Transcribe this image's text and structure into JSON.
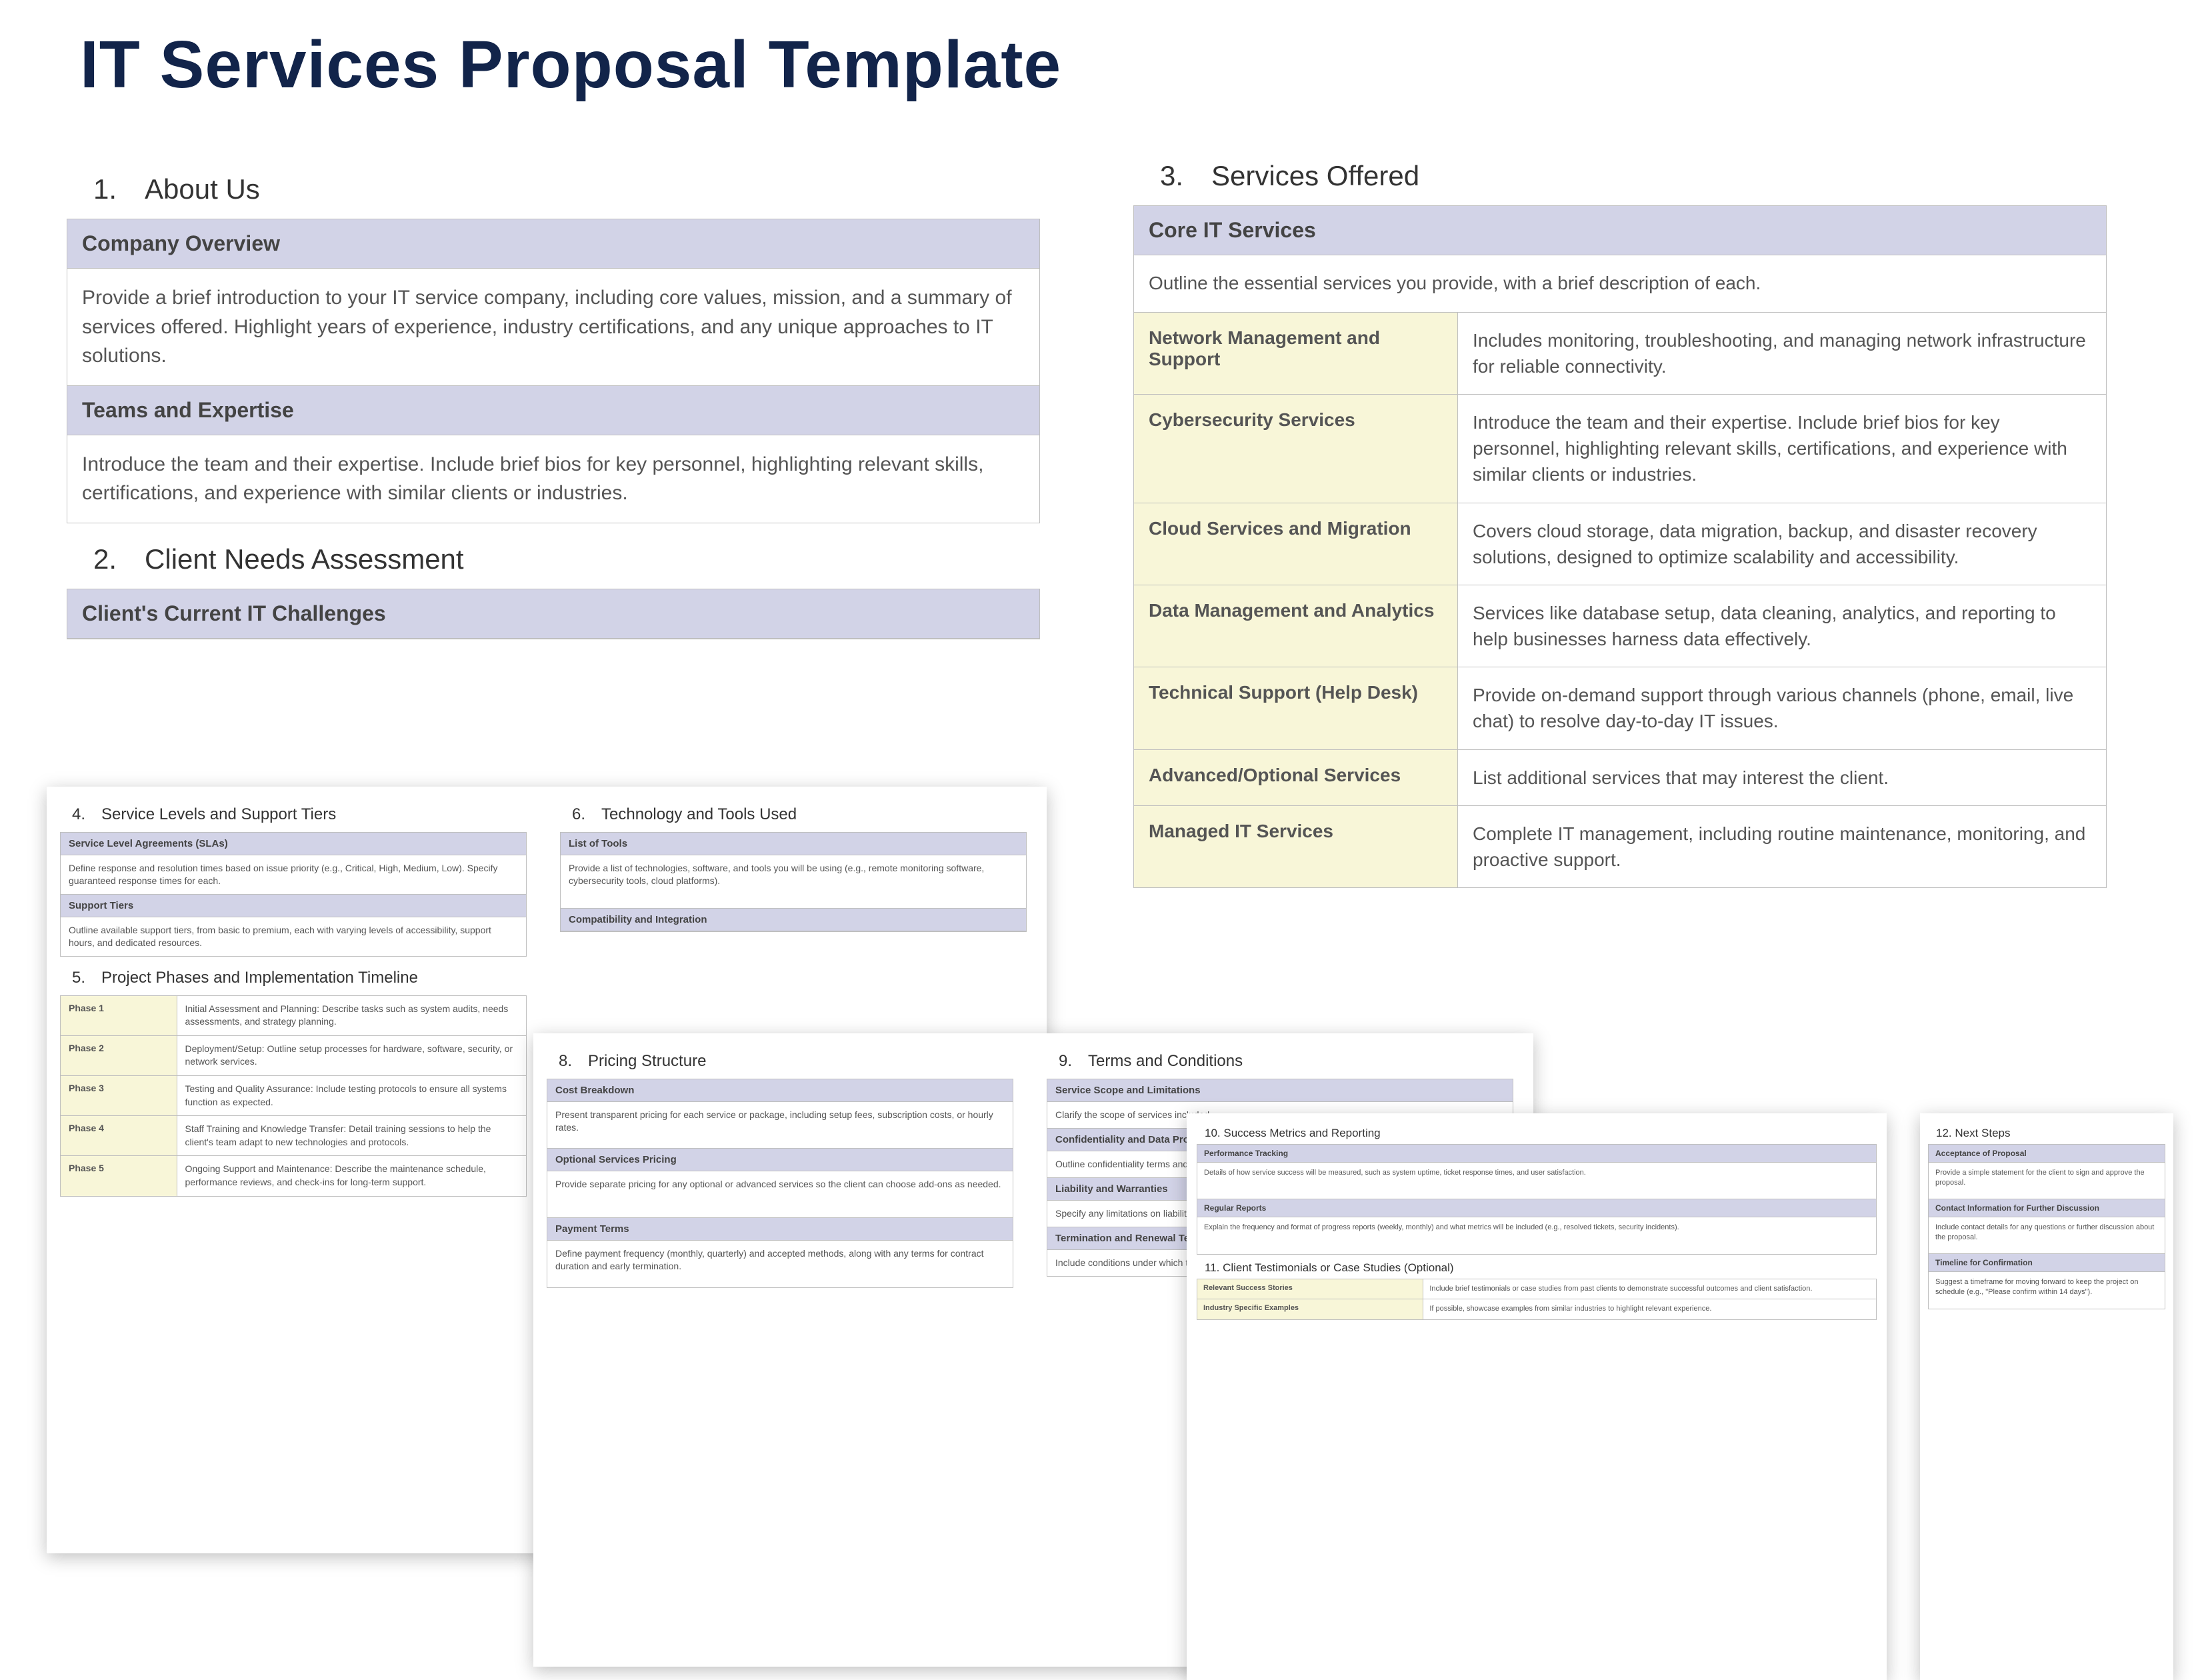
{
  "title": "IT Services Proposal Template",
  "s1": {
    "heading": "1. About Us",
    "h1": "Company Overview",
    "b1": "Provide a brief introduction to your IT service company, including core values, mission, and a summary of services offered. Highlight years of experience, industry certifications, and any unique approaches to IT solutions.",
    "h2": "Teams and Expertise",
    "b2": "Introduce the team and their expertise. Include brief bios for key personnel, highlighting relevant skills, certifications, and experience with similar clients or industries."
  },
  "s2": {
    "heading": "2. Client Needs Assessment",
    "h1": "Client's Current IT Challenges"
  },
  "s3": {
    "heading": "3. Services Offered",
    "h1": "Core IT Services",
    "intro": "Outline the essential services you provide, with a brief description of each.",
    "rows": [
      {
        "l": "Network Management and Support",
        "r": "Includes monitoring, troubleshooting, and managing network infrastructure for reliable connectivity."
      },
      {
        "l": "Cybersecurity Services",
        "r": "Introduce the team and their expertise. Include brief bios for key personnel, highlighting relevant skills, certifications, and experience with similar clients or industries."
      },
      {
        "l": "Cloud Services and Migration",
        "r": "Covers cloud storage, data migration, backup, and disaster recovery solutions, designed to optimize scalability and accessibility."
      },
      {
        "l": "Data Management and Analytics",
        "r": "Services like database setup, data cleaning, analytics, and reporting to help businesses harness data effectively."
      },
      {
        "l": "Technical Support (Help Desk)",
        "r": "Provide on-demand support through various channels (phone, email, live chat) to resolve day-to-day IT issues."
      },
      {
        "l": "Advanced/Optional Services",
        "r": "List additional services that may interest the client."
      },
      {
        "l": "Managed IT Services",
        "r": "Complete IT management, including routine maintenance, monitoring, and proactive support."
      }
    ]
  },
  "s4": {
    "heading": "4. Service Levels and Support Tiers",
    "h1": "Service Level Agreements (SLAs)",
    "b1": "Define response and resolution times based on issue priority (e.g., Critical, High, Medium, Low). Specify guaranteed response times for each.",
    "h2": "Support Tiers",
    "b2": "Outline available support tiers, from basic to premium, each with varying levels of accessibility, support hours, and dedicated resources."
  },
  "s5": {
    "heading": "5. Project Phases and Implementation Timeline",
    "rows": [
      {
        "l": "Phase 1",
        "r": "Initial Assessment and Planning: Describe tasks such as system audits, needs assessments, and strategy planning."
      },
      {
        "l": "Phase 2",
        "r": "Deployment/Setup: Outline setup processes for hardware, software, security, or network services."
      },
      {
        "l": "Phase 3",
        "r": "Testing and Quality Assurance: Include testing protocols to ensure all systems function as expected."
      },
      {
        "l": "Phase 4",
        "r": "Staff Training and Knowledge Transfer: Detail training sessions to help the client's team adapt to new technologies and protocols."
      },
      {
        "l": "Phase 5",
        "r": "Ongoing Support and Maintenance: Describe the maintenance schedule, performance reviews, and check-ins for long-term support."
      }
    ]
  },
  "s6": {
    "heading": "6. Technology and Tools Used",
    "h1": "List of Tools",
    "b1": "Provide a list of technologies, software, and tools you will be using (e.g., remote monitoring software, cybersecurity tools, cloud platforms).",
    "h2": "Compatibility and Integration"
  },
  "s8": {
    "heading": "8. Pricing Structure",
    "h1": "Cost Breakdown",
    "b1": "Present transparent pricing for each service or package, including setup fees, subscription costs, or hourly rates.",
    "h2": "Optional Services Pricing",
    "b2": "Provide separate pricing for any optional or advanced services so the client can choose add-ons as needed.",
    "h3": "Payment Terms",
    "b3": "Define payment frequency (monthly, quarterly) and accepted methods, along with any terms for contract duration and early termination."
  },
  "s9": {
    "heading": "9. Terms and Conditions",
    "h1": "Service Scope and Limitations",
    "b1": "Clarify the scope of services included.",
    "h2": "Confidentiality and Data Protection",
    "b2": "Outline confidentiality terms and data protection measures.",
    "h3": "Liability and Warranties",
    "b3": "Specify any limitations on liability.",
    "h4": "Termination and Renewal Terms",
    "b4": "Include conditions under which the agreement may be terminated or renewed."
  },
  "s10": {
    "heading": "10. Success Metrics and Reporting",
    "h1": "Performance Tracking",
    "b1": "Details of how service success will be measured, such as system uptime, ticket response times, and user satisfaction.",
    "h2": "Regular Reports",
    "b2": "Explain the frequency and format of progress reports (weekly, monthly) and what metrics will be included (e.g., resolved tickets, security incidents)."
  },
  "s11": {
    "heading": "11. Client Testimonials or Case Studies (Optional)",
    "rows": [
      {
        "l": "Relevant Success Stories",
        "r": "Include brief testimonials or case studies from past clients to demonstrate successful outcomes and client satisfaction."
      },
      {
        "l": "Industry Specific Examples",
        "r": "If possible, showcase examples from similar industries to highlight relevant experience."
      }
    ]
  },
  "s12": {
    "heading": "12. Next Steps",
    "h1": "Acceptance of Proposal",
    "b1": "Provide a simple statement for the client to sign and approve the proposal.",
    "h2": "Contact Information for Further Discussion",
    "b2": "Include contact details for any questions or further discussion about the proposal.",
    "h3": "Timeline for Confirmation",
    "b3": "Suggest a timeframe for moving forward to keep the project on schedule (e.g., \"Please confirm within 14 days\")."
  }
}
